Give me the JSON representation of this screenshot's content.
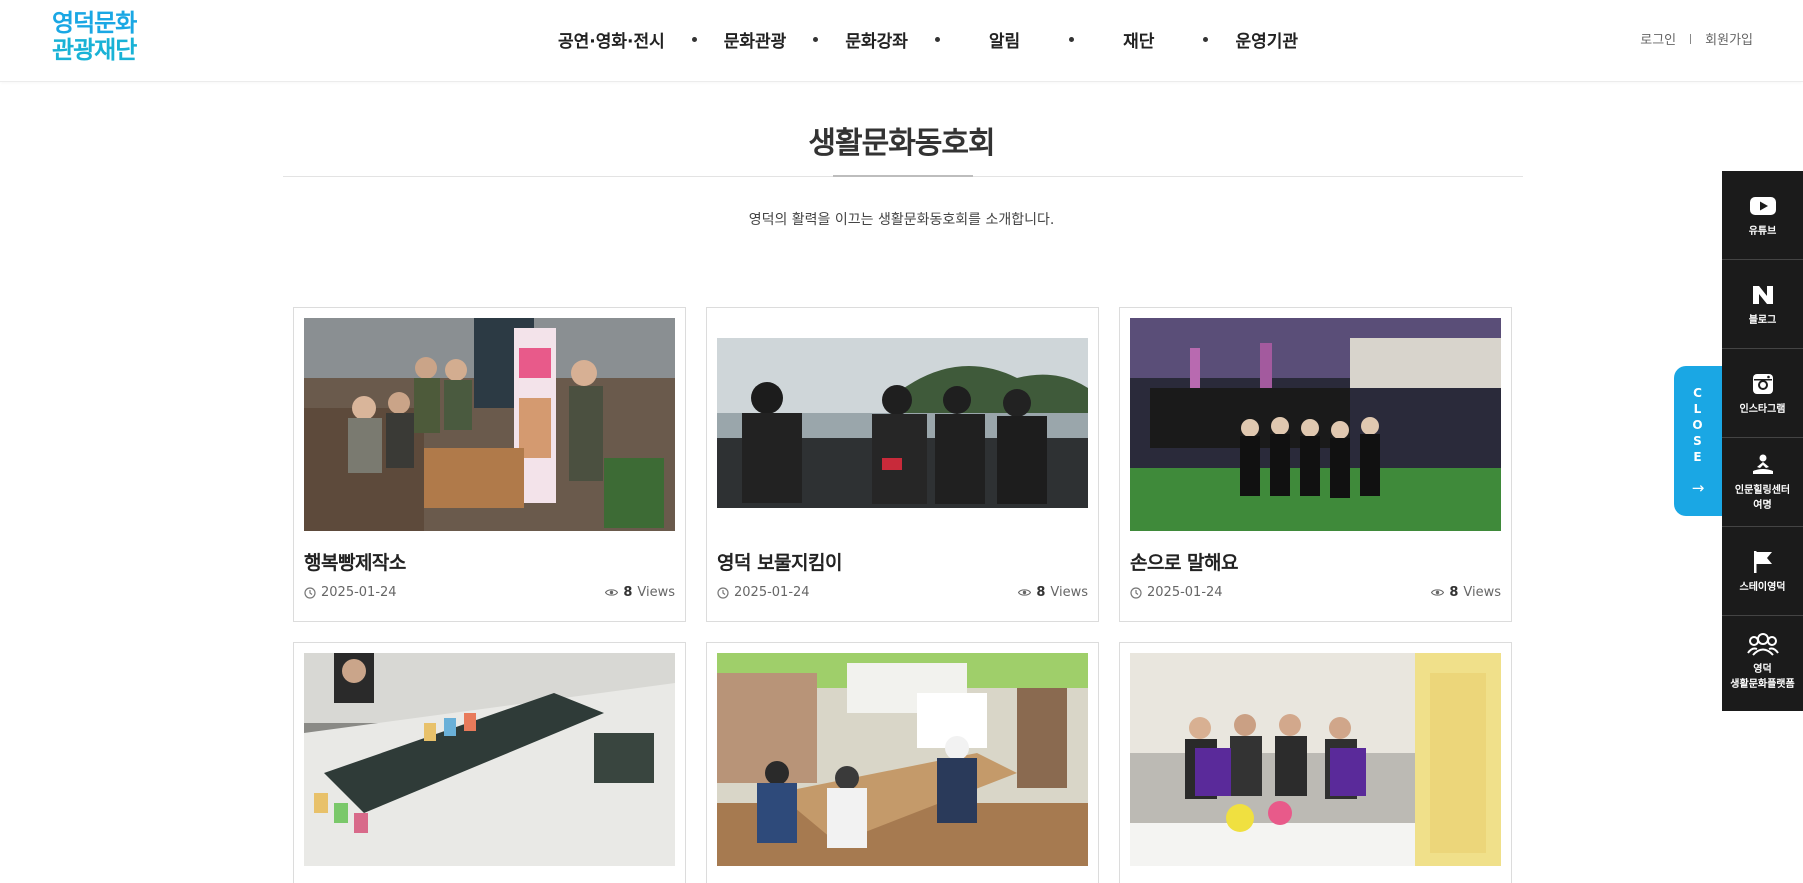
{
  "header": {
    "logo_line1": "영덕문화",
    "logo_line2": "관광재단",
    "nav": [
      "공연·영화·전시",
      "문화관광",
      "문화강좌",
      "알림",
      "재단",
      "운영기관"
    ],
    "login": "로그인",
    "signup": "회원가입"
  },
  "page": {
    "title": "생활문화동호회",
    "subtitle": "영덕의 활력을 이끄는 생활문화동호회를 소개합니다."
  },
  "cards": [
    {
      "title": "행복빵제작소",
      "date": "2025-01-24",
      "views": "8",
      "views_unit": "Views"
    },
    {
      "title": "영덕 보물지킴이",
      "date": "2025-01-24",
      "views": "8",
      "views_unit": "Views"
    },
    {
      "title": "손으로 말해요",
      "date": "2025-01-24",
      "views": "8",
      "views_unit": "Views"
    },
    {
      "title": "",
      "date": "",
      "views": "",
      "views_unit": ""
    },
    {
      "title": "",
      "date": "",
      "views": "",
      "views_unit": ""
    },
    {
      "title": "",
      "date": "",
      "views": "",
      "views_unit": ""
    }
  ],
  "quick_menu": {
    "close": "CLOSE",
    "items": [
      {
        "label": "유튜브",
        "icon": "youtube-icon"
      },
      {
        "label": "블로그",
        "icon": "naver-blog-icon"
      },
      {
        "label": "인스타그램",
        "icon": "instagram-icon"
      },
      {
        "label": "인문힐링센터\n여명",
        "icon": "meditation-icon"
      },
      {
        "label": "스테이영덕",
        "icon": "flag-icon"
      },
      {
        "label": "영덕\n생활문화플랫폼",
        "icon": "people-icon"
      }
    ]
  },
  "colors": {
    "accent": "#1aa7e4",
    "quick_bg": "#1b1b1b"
  }
}
